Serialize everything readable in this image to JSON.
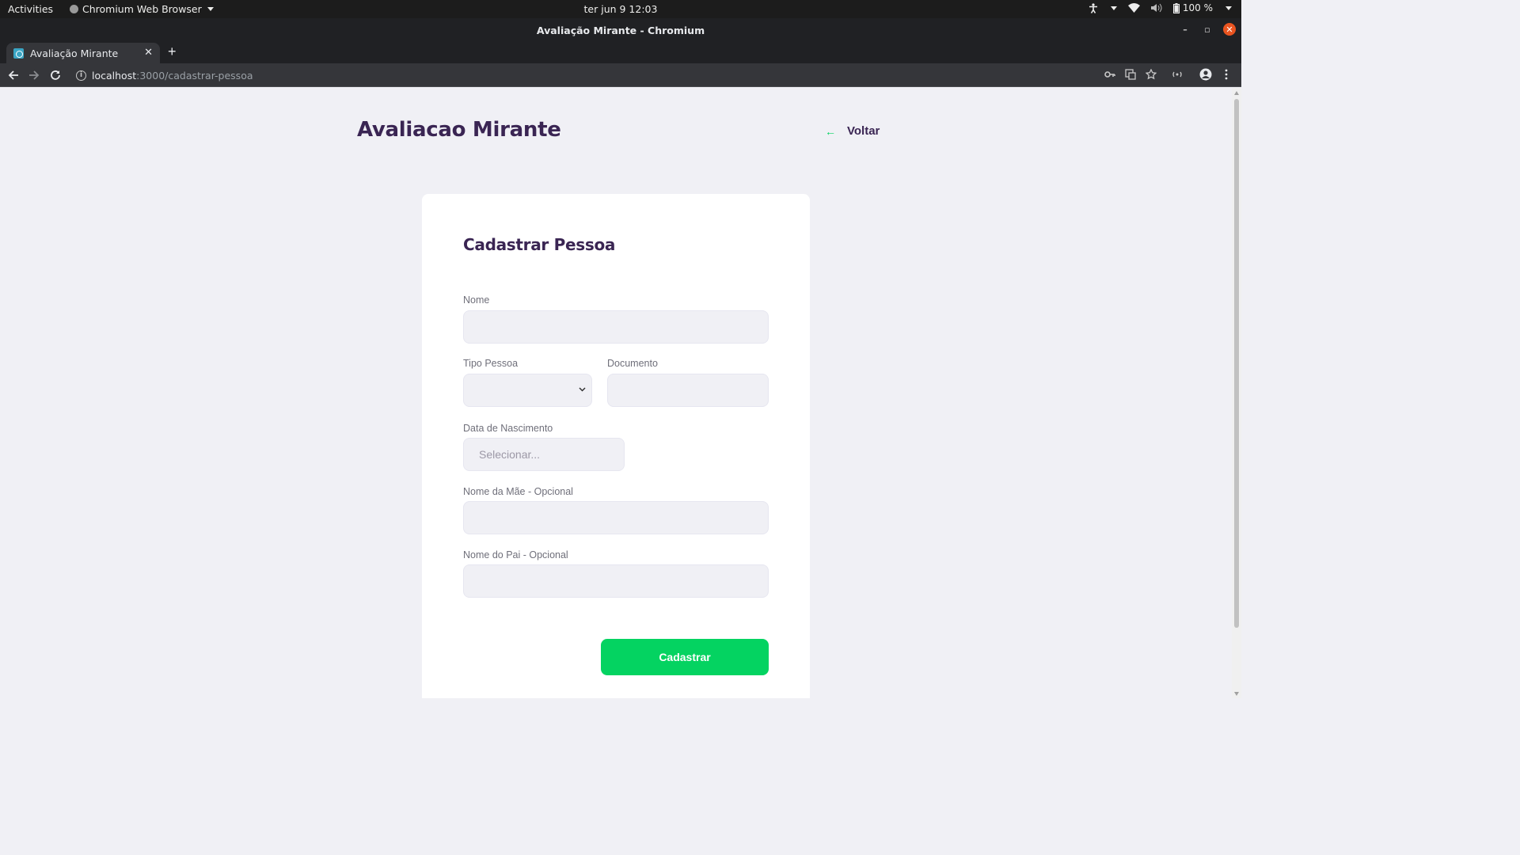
{
  "system_bar": {
    "activities": "Activities",
    "app_menu": "Chromium Web Browser",
    "clock": "ter jun 9  12:03",
    "battery": "100 %"
  },
  "window": {
    "title": "Avaliação Mirante - Chromium"
  },
  "tabs": [
    {
      "label": "Avaliação Mirante",
      "active": true
    }
  ],
  "address_bar": {
    "host": "localhost",
    "path": ":3000/cadastrar-pessoa"
  },
  "page": {
    "app_title": "Avaliacao Mirante",
    "back_label": "Voltar",
    "form": {
      "title": "Cadastrar Pessoa",
      "nome_label": "Nome",
      "nome_value": "",
      "tipo_label": "Tipo Pessoa",
      "tipo_value": "",
      "documento_label": "Documento",
      "documento_value": "",
      "nascimento_label": "Data de Nascimento",
      "nascimento_placeholder": "Selecionar...",
      "mae_label": "Nome da Mãe - Opcional",
      "mae_value": "",
      "pai_label": "Nome do Pai - Opcional",
      "pai_value": "",
      "submit_label": "Cadastrar"
    }
  },
  "colors": {
    "accent_green": "#04d361",
    "title_purple": "#3a2553",
    "page_bg": "#f0f0f5"
  }
}
